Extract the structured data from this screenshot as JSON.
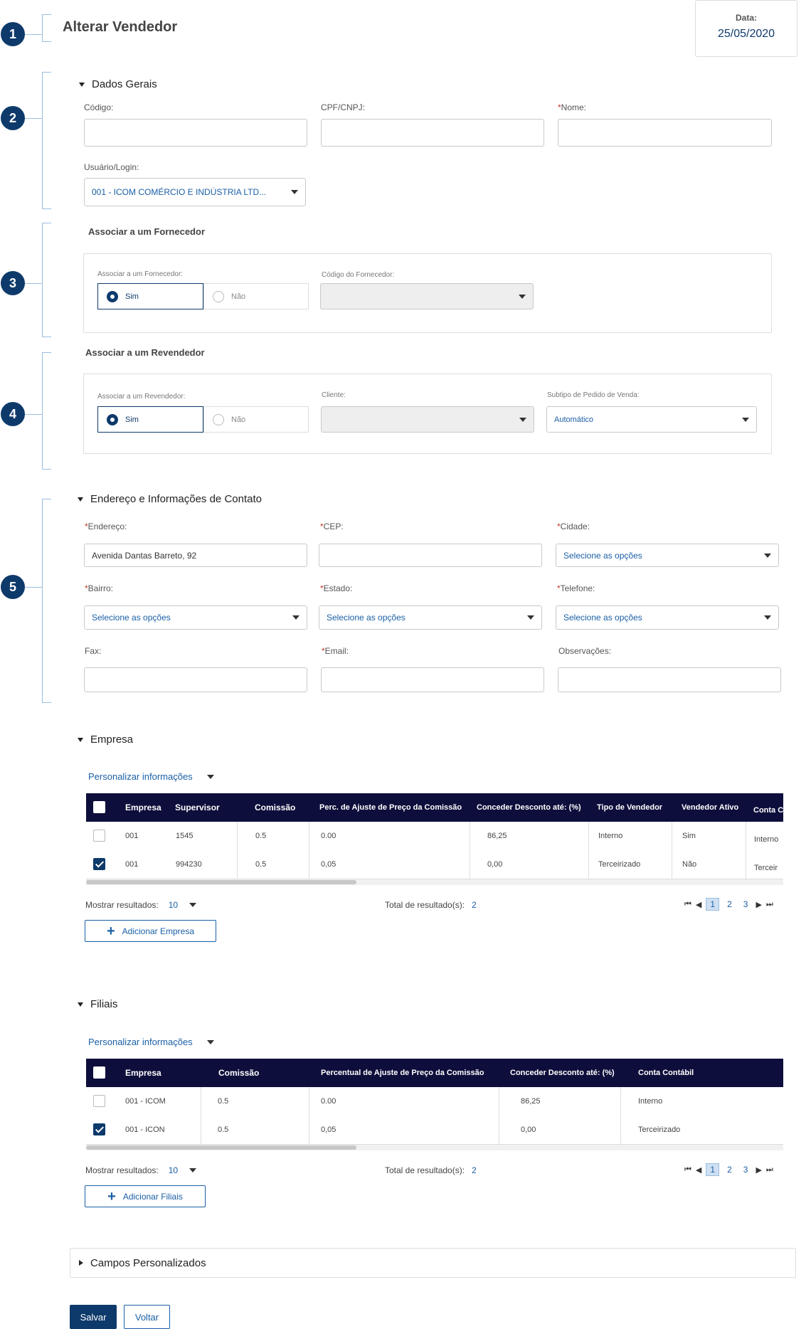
{
  "header": {
    "title": "Alterar Vendedor",
    "date_label": "Data:",
    "date_value": "25/05/2020"
  },
  "badges": [
    "1",
    "2",
    "3",
    "4",
    "5"
  ],
  "dados_gerais": {
    "title": "Dados Gerais",
    "codigo_label": "Código:",
    "cpf_label": "CPF/CNPJ:",
    "nome_req": "*",
    "nome_label": "Nome:",
    "usuario_label": "Usuário/Login:",
    "usuario_value": "001 - ICOM COMÉRCIO E INDÚSTRIA LTD..."
  },
  "fornecedor": {
    "title": "Associar a um Fornecedor",
    "assoc_label": "Associar a um Fornecedor:",
    "sim": "Sim",
    "nao": "Não",
    "codigo_label": "Código do Fornecedor:"
  },
  "revendedor": {
    "title": "Associar a um Revendedor",
    "assoc_label": "Associar a um Revendedor:",
    "sim": "Sim",
    "nao": "Não",
    "cliente_label": "Cliente:",
    "subtipo_label": "Subtipo de Pedido de Venda:",
    "subtipo_value": "Automático"
  },
  "endereco": {
    "title": "Endereço e Informações de Contato",
    "req": "*",
    "endereco_label": "Endereço:",
    "endereco_value": "Avenida Dantas Barreto, 92",
    "cep_label": "CEP:",
    "cidade_label": "Cidade:",
    "cidade_value": "Selecione as opções",
    "bairro_label": "Bairro:",
    "bairro_value": "Selecione as opções",
    "estado_label": "Estado:",
    "estado_value": "Selecione as opções",
    "telefone_label": "Telefone:",
    "telefone_value": "Selecione as opções",
    "fax_label": "Fax:",
    "email_label": "Email:",
    "obs_label": "Observações:"
  },
  "empresa": {
    "title": "Empresa",
    "personalizar": "Personalizar informações",
    "columns": [
      "Empresa",
      "Supervisor",
      "Comissão",
      "Perc. de Ajuste de Preço da Comissão",
      "Conceder Desconto até: (%)",
      "Tipo de Vendedor",
      "Vendedor Ativo",
      "Conta C"
    ],
    "rows": [
      {
        "checked": false,
        "cells": [
          "001",
          "1545",
          "0.5",
          "0.00",
          "86,25",
          "Interno",
          "Sim",
          "Interno"
        ]
      },
      {
        "checked": true,
        "cells": [
          "001",
          "994230",
          "0.5",
          "0,05",
          "0,00",
          "Terceirizado",
          "Não",
          "Terceir"
        ]
      }
    ],
    "mostrar_label": "Mostrar resultados:",
    "mostrar_value": "10",
    "total_label": "Total de resultado(s):",
    "total_value": "2",
    "pages": [
      "1",
      "2",
      "3"
    ],
    "add_button": "Adicionar Empresa"
  },
  "filiais": {
    "title": "Filiais",
    "personalizar": "Personalizar informações",
    "columns": [
      "Empresa",
      "Comissão",
      "Percentual de Ajuste de Preço da Comissão",
      "Conceder Desconto até: (%)",
      "Conta Contábil"
    ],
    "rows": [
      {
        "checked": false,
        "cells": [
          "001 - ICOM",
          "0.5",
          "0.00",
          "86,25",
          "Interno"
        ]
      },
      {
        "checked": true,
        "cells": [
          "001 - ICON",
          "0.5",
          "0,05",
          "0,00",
          "Terceirizado"
        ]
      }
    ],
    "mostrar_label": "Mostrar resultados:",
    "mostrar_value": "10",
    "total_label": "Total de resultado(s):",
    "total_value": "2",
    "pages": [
      "1",
      "2",
      "3"
    ],
    "add_button": "Adicionar Filiais"
  },
  "campos": {
    "title": "Campos Personalizados"
  },
  "footer": {
    "salvar": "Salvar",
    "voltar": "Voltar"
  }
}
